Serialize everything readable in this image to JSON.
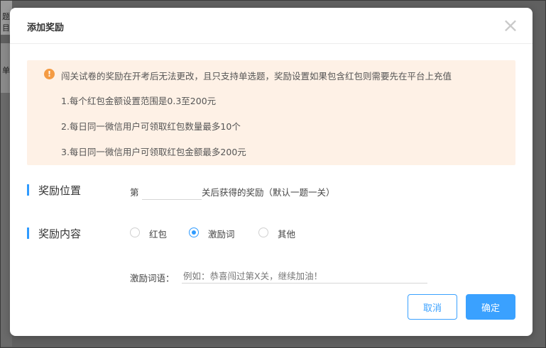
{
  "background": {
    "fragment_1": "题目",
    "fragment_2": "单"
  },
  "dialog": {
    "title": "添加奖励",
    "close_symbol": "×",
    "notice": {
      "icon": "!",
      "line_main": "闯关试卷的奖励在开考后无法更改，且只支持单选题，奖励设置如果包含红包则需要先在平台上充值",
      "rules": [
        "1.每个红包金额设置范围是0.3至200元",
        "2.每日同一微信用户可领取红包数量最多10个",
        "3.每日同一微信用户可领取红包金额最多200元"
      ]
    },
    "position": {
      "label": "奖励位置",
      "prefix": "第",
      "value": "",
      "suffix": "关后获得的奖励（默认一题一关）"
    },
    "content": {
      "label": "奖励内容",
      "options": [
        "红包",
        "激励词",
        "其他"
      ],
      "selected": "激励词"
    },
    "words": {
      "label": "激励词语：",
      "value": "",
      "placeholder": "例如：恭喜闯过第X关，继续加油！"
    },
    "buttons": {
      "cancel": "取消",
      "confirm": "确定"
    }
  },
  "colors": {
    "accent": "#3aa1ff",
    "warning": "#f49b43",
    "notice_bg": "#fef1e6"
  }
}
